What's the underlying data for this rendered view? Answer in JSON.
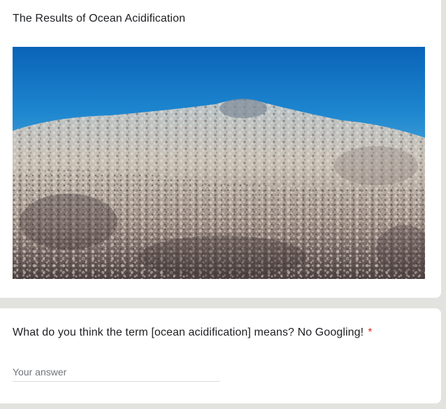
{
  "image_item": {
    "title": "The Results of Ocean Acidification",
    "image_subject": "bleached-coral-reef-underwater-photo"
  },
  "question_item": {
    "title": "What do you think the term [ocean acidification] means? No Googling!",
    "required_marker": "*",
    "answer_placeholder": "Your answer",
    "answer_value": ""
  },
  "colors": {
    "page_background": "#e2e2df",
    "card_background": "#ffffff",
    "text_primary": "#202124",
    "required_red": "#d93025",
    "placeholder_gray": "#70757a",
    "underline_gray": "#dadce0"
  }
}
